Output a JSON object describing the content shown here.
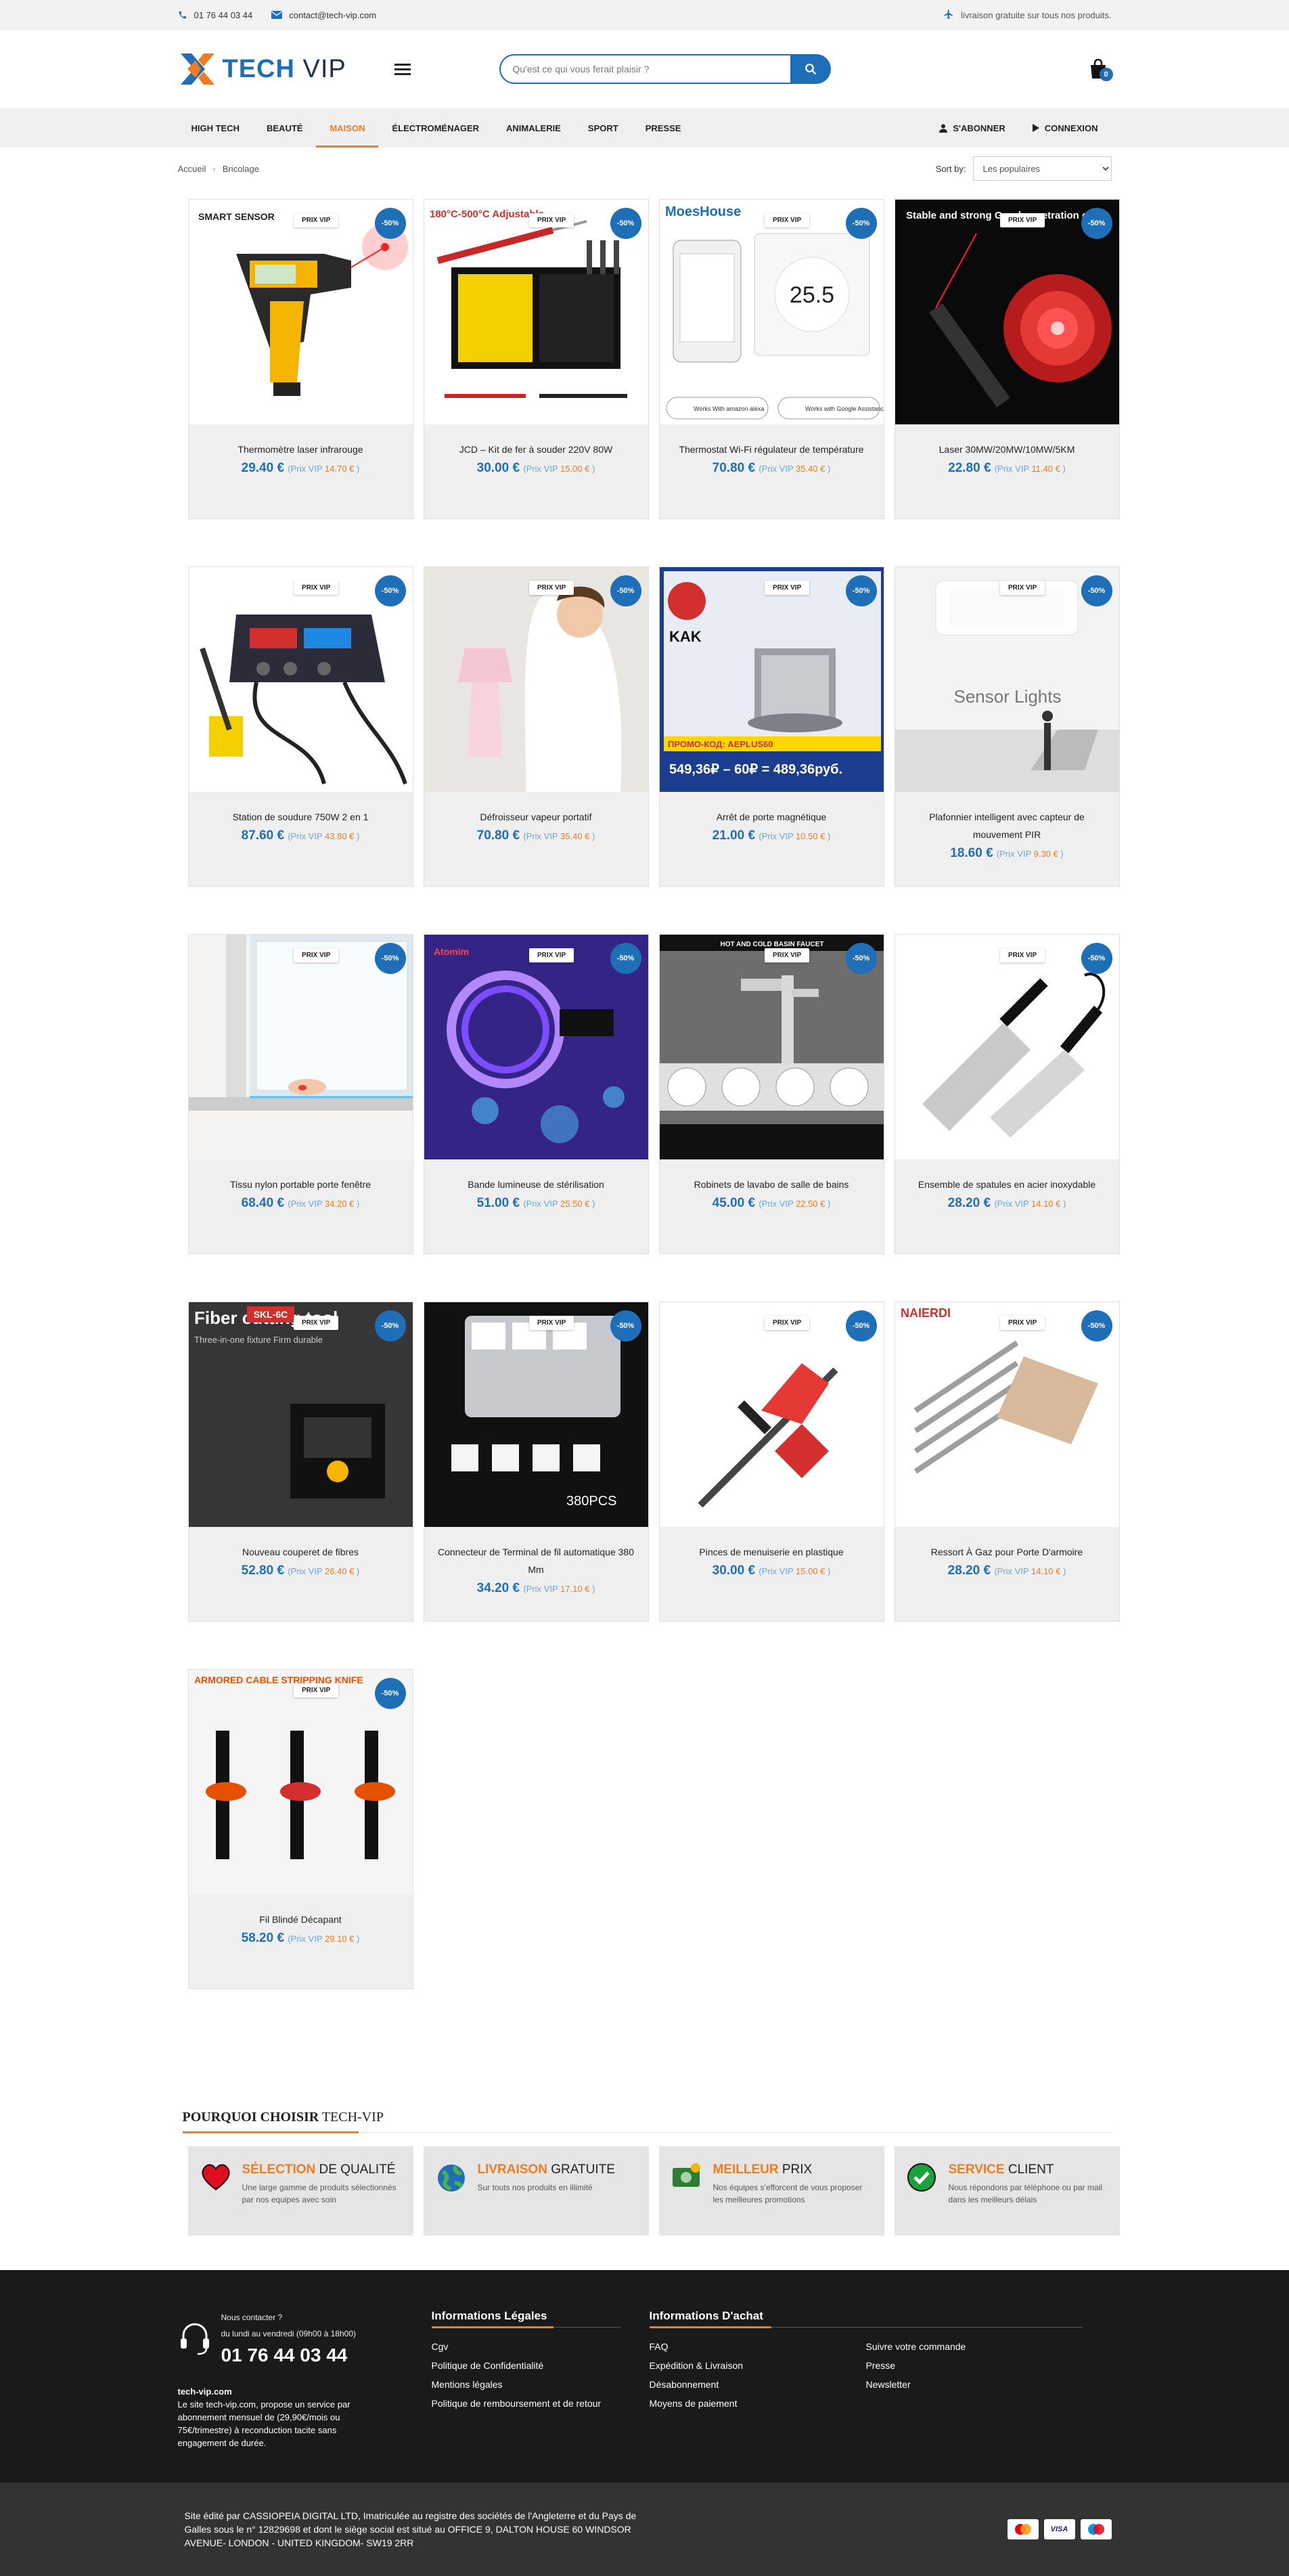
{
  "topbar": {
    "phone": "01 76 44 03 44",
    "email": "contact@tech-vip.com",
    "shipping": "livraison gratuite sur tous nos produits."
  },
  "header": {
    "logo_main": "TECH",
    "logo_accent": "VIP",
    "search_placeholder": "Qu'est ce qui vous ferait plaisir ?",
    "cart_count": "0"
  },
  "nav": {
    "items": [
      "High Tech",
      "Beauté",
      "Maison",
      "Électroménager",
      "Animalerie",
      "Sport",
      "Presse"
    ],
    "active_index": 2,
    "subscribe": "S'abonner",
    "login": "Connexion"
  },
  "breadcrumb": [
    "Accueil",
    "Bricolage"
  ],
  "sort": {
    "label": "Sort by:",
    "selected": "Les populaires"
  },
  "product_labels": {
    "vip_badge": "PRIX VIP",
    "discount": "-50%",
    "vip_prefix": "Prix VIP"
  },
  "products": [
    {
      "name": "Thermomètre laser infrarouge",
      "price": "29.40 €",
      "vip": "14.70 €"
    },
    {
      "name": "JCD – Kit de fer à souder 220V 80W",
      "price": "30.00 €",
      "vip": "15.00 €"
    },
    {
      "name": "Thermostat Wi-Fi régulateur de température",
      "price": "70.80 €",
      "vip": "35.40 €"
    },
    {
      "name": "Laser 30MW/20MW/10MW/5KM",
      "price": "22.80 €",
      "vip": "11.40 €"
    },
    {
      "name": "Station de soudure 750W 2 en 1",
      "price": "87.60 €",
      "vip": "43.80 €"
    },
    {
      "name": "Défroisseur vapeur portatif",
      "price": "70.80 €",
      "vip": "35.40 €"
    },
    {
      "name": "Arrêt de porte magnétique",
      "price": "21.00 €",
      "vip": "10.50 €"
    },
    {
      "name": "Plafonnier intelligent avec capteur de mouvement PIR",
      "price": "18.60 €",
      "vip": "9.30 €"
    },
    {
      "name": "Tissu nylon portable porte fenêtre",
      "price": "68.40 €",
      "vip": "34.20 €"
    },
    {
      "name": "Bande lumineuse de stérilisation",
      "price": "51.00 €",
      "vip": "25.50 €"
    },
    {
      "name": "Robinets de lavabo de salle de bains",
      "price": "45.00 €",
      "vip": "22.50 €"
    },
    {
      "name": "Ensemble de spatules en acier inoxydable",
      "price": "28.20 €",
      "vip": "14.10 €"
    },
    {
      "name": "Nouveau couperet de fibres",
      "price": "52.80 €",
      "vip": "26.40 €"
    },
    {
      "name": "Connecteur de Terminal de fil automatique 380 Mm",
      "price": "34.20 €",
      "vip": "17.10 €"
    },
    {
      "name": "Pinces de menuiserie en plastique",
      "price": "30.00 €",
      "vip": "15.00 €"
    },
    {
      "name": "Ressort À Gaz pour Porte D'armoire",
      "price": "28.20 €",
      "vip": "14.10 €"
    },
    {
      "name": "Fil Blindé Décapant",
      "price": "58.20 €",
      "vip": "29.10 €"
    }
  ],
  "product_image_text": {
    "p1": "SMART SENSOR",
    "p2": "180°C-500°C Adjustable",
    "p3": "MoesHouse",
    "p3_alexa": "Works With amazon alexa",
    "p3_google": "Works with Google Assistance",
    "p4": "Stable and strong Good penetration effect",
    "p7_brand": "KAK",
    "p7_promo": "ПРОМО-КОД: AEPLUS60",
    "p7_price": "549,36₽ – 60₽ = 489,36руб.",
    "p8": "Sensor Lights",
    "p10": "Atomim",
    "p11": "HOT AND COLD BASIN FAUCET",
    "p13_title": "Fiber cutting tool",
    "p13_model": "SKL-6C",
    "p13_sub": "Three-in-one fixture Firm durable",
    "p14": "380PCS",
    "p16": "NAIERDI",
    "p17": "ARMORED CABLE STRIPPING KNIFE"
  },
  "why": {
    "title_a": "POURQUOI CHOISIR",
    "title_b": "TECH-VIP",
    "cards": [
      {
        "accent": "SÉLECTION",
        "rest": " DE QUALITÉ",
        "desc": "Une large gamme de produits sélectionnés par nos equipes avec soin",
        "icon": "heart-icon"
      },
      {
        "accent": "LIVRAISON",
        "rest": " GRATUITE",
        "desc": "Sur touts nos produits en illimité",
        "icon": "globe-icon"
      },
      {
        "accent": "MEILLEUR",
        "rest": " PRIX",
        "desc": "Nos équipes s'efforcent de vous proposer les meilleures promotions",
        "icon": "money-icon"
      },
      {
        "accent": "SERVICE",
        "rest": " CLIENT",
        "desc": "Nous répondons par téléphone ou par mail dans les meilleurs délais",
        "icon": "check-icon"
      }
    ]
  },
  "footer": {
    "contact_label": "Nous contacter ?",
    "hours": "du lundi au vendredi (09h00 à 18h00)",
    "phone": "01 76 44 03 44",
    "site": "tech-vip.com",
    "desc": "Le site tech-vip.com, propose un service par abonnement mensuel de (29,90€/mois ou 75€/trimestre) à reconduction tacite sans engagement de durée.",
    "legal_title": "Informations Légales",
    "legal_links": [
      "Cgv",
      "Politique de Confidentialité",
      "Mentions légales",
      "Politique de remboursement et de retour"
    ],
    "buy_title": "Informations D'achat",
    "buy_links": [
      "FAQ",
      "Suivre votre commande",
      "Expédition & Livraison",
      "Presse",
      "Désabonnement",
      "Newsletter",
      "Moyens de paiement"
    ],
    "company": "Site édité par CASSIOPEIA DIGITAL LTD, Imatriculée au registre des sociétés de l'Angleterre et du Pays de Galles sous le n° 12829698 et dont le siège social est situé au OFFICE 9, DALTON HOUSE 60 WINDSOR AVENUE- LONDON - UNITED KINGDOM- SW19 2RR",
    "payments": [
      "mastercard",
      "VISA",
      "Maestro"
    ]
  }
}
